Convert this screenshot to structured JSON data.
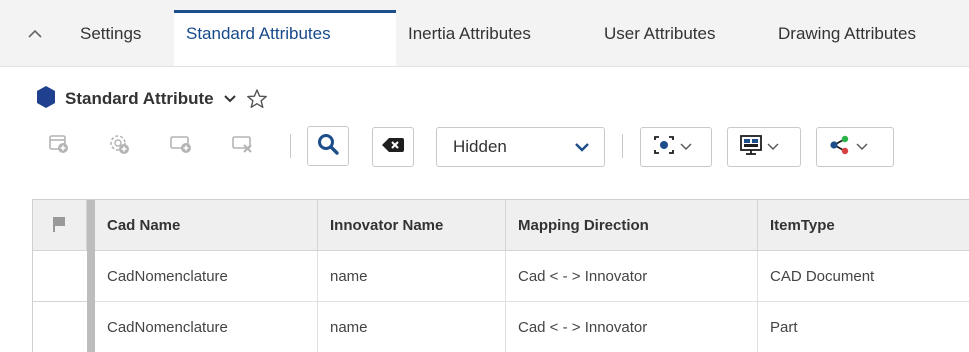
{
  "tabs": {
    "collapse_icon": "chevron-up-icon",
    "items": [
      {
        "label": "Settings",
        "active": false
      },
      {
        "label": "Standard Attributes",
        "active": true
      },
      {
        "label": "Inertia Attributes",
        "active": false
      },
      {
        "label": "User Attributes",
        "active": false
      },
      {
        "label": "Drawing Attributes",
        "active": false
      }
    ]
  },
  "header": {
    "title": "Standard Attribute",
    "item_icon": "hexagon-icon",
    "item_icon_color": "#1f3f8f",
    "favorite_icon": "star-outline-icon"
  },
  "toolbar": {
    "buttons": [
      {
        "icon": "new-item-icon",
        "enabled": false
      },
      {
        "icon": "settings-add-icon",
        "enabled": false
      },
      {
        "icon": "add-row-icon",
        "enabled": false
      },
      {
        "icon": "delete-row-icon",
        "enabled": false
      },
      {
        "icon": "search-icon",
        "enabled": true
      },
      {
        "icon": "clear-search-icon",
        "enabled": true
      }
    ],
    "search_mode": "Hidden",
    "dropdowns": [
      {
        "icon": "view-mode-icon"
      },
      {
        "icon": "layout-icon"
      },
      {
        "icon": "share-icon"
      }
    ],
    "accent_color": "#1d4e89"
  },
  "grid": {
    "columns": [
      "Cad Name",
      "Innovator Name",
      "Mapping Direction",
      "ItemType"
    ],
    "rows": [
      [
        "CadNomenclature",
        "name",
        "Cad < - > Innovator",
        "CAD Document"
      ],
      [
        "CadNomenclature",
        "name",
        "Cad < - > Innovator",
        "Part"
      ]
    ]
  }
}
